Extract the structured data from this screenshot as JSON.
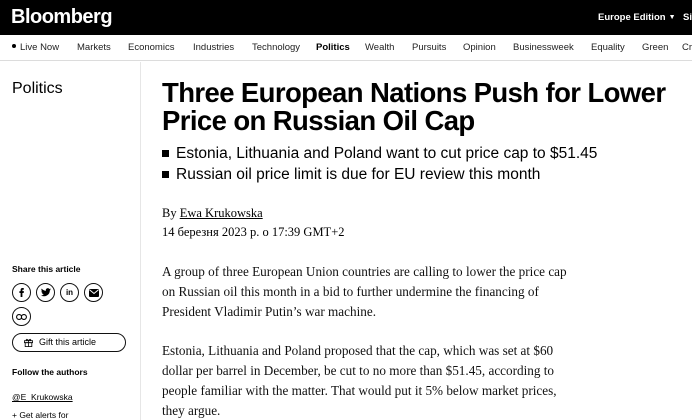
{
  "header": {
    "logo": "Bloomberg",
    "edition": "Europe Edition",
    "signin": "Sig"
  },
  "nav": {
    "items": [
      "Live Now",
      "Markets",
      "Economics",
      "Industries",
      "Technology",
      "Politics",
      "Wealth",
      "Pursuits",
      "Opinion",
      "Businessweek",
      "Equality",
      "Green",
      "Cr"
    ],
    "active": "Politics"
  },
  "rail": {
    "section": "Politics",
    "share_title": "Share this article",
    "share_icons": [
      "facebook-icon",
      "twitter-icon",
      "linkedin-icon",
      "email-icon",
      "link-icon"
    ],
    "gift_label": "Gift this article",
    "follow_title": "Follow the authors",
    "author_handle": "@E_Krukowska",
    "alerts_label": "+ Get alerts for"
  },
  "article": {
    "headline": "Three European Nations Push for Lower Price on Russian Oil Cap",
    "bullets": [
      "Estonia, Lithuania and Poland want to cut price cap to $51.45",
      "Russian oil price limit is due for EU review this month"
    ],
    "by_prefix": "By",
    "author": "Ewa Krukowska",
    "date": "14 березня 2023 р. о 17:39 GMT+2",
    "paragraphs": [
      "A group of three European Union countries are calling to lower the price cap on Russian oil this month in a bid to further undermine the financing of President Vladimir Putin’s war machine.",
      "Estonia, Lithuania and Poland proposed that the cap, which was set at $60 dollar per barrel in December, be cut to no more than $51.45, according to people familiar with the matter. That would put it 5% below market prices, they argue."
    ]
  }
}
